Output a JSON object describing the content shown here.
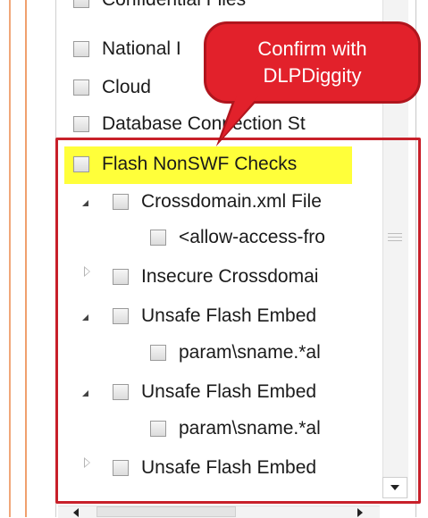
{
  "tree": {
    "items": [
      {
        "label": "Confidential Files",
        "indent": 0,
        "expander": "none"
      },
      {
        "label": "National I",
        "indent": 0,
        "expander": "none"
      },
      {
        "label": "Cloud",
        "indent": 0,
        "expander": "none"
      },
      {
        "label": "Database Connection St",
        "indent": 0,
        "expander": "none"
      },
      {
        "label": "Flash NonSWF Checks",
        "indent": 0,
        "expander": "none"
      },
      {
        "label": "Crossdomain.xml File",
        "indent": 1,
        "expander": "open"
      },
      {
        "label": "<allow-access-fro",
        "indent": 2,
        "expander": "none"
      },
      {
        "label": "Insecure Crossdomai",
        "indent": 1,
        "expander": "closed"
      },
      {
        "label": "Unsafe Flash Embed",
        "indent": 1,
        "expander": "open"
      },
      {
        "label": "param\\sname.*al",
        "indent": 2,
        "expander": "none"
      },
      {
        "label": "Unsafe Flash Embed",
        "indent": 1,
        "expander": "open"
      },
      {
        "label": "param\\sname.*al",
        "indent": 2,
        "expander": "none"
      },
      {
        "label": "Unsafe Flash Embed",
        "indent": 1,
        "expander": "closed"
      }
    ]
  },
  "callout": {
    "line1": "Confirm with",
    "line2": "DLPDiggity"
  },
  "colors": {
    "highlight": "#ffff3a",
    "annotation_red": "#e2212b",
    "accent_orange": "#f1a77a"
  }
}
